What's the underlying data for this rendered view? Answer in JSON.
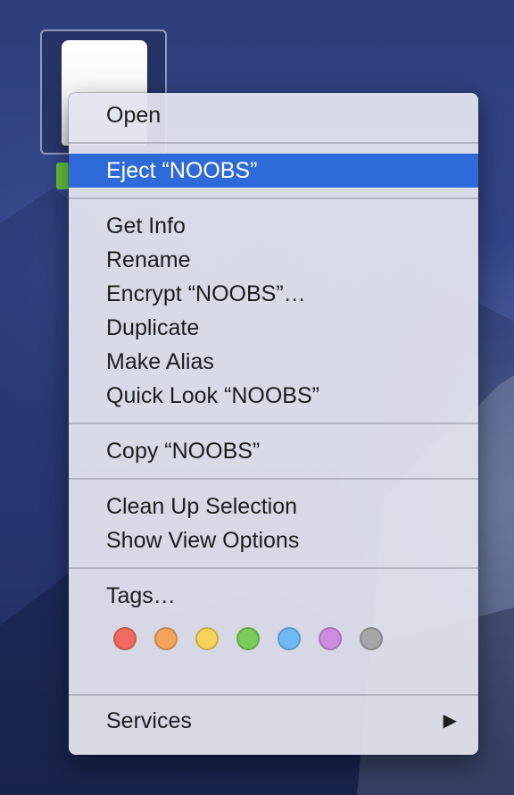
{
  "menu": {
    "groups": [
      {
        "items": [
          "Open"
        ]
      },
      {
        "items": [
          "Eject “NOOBS”"
        ]
      },
      {
        "items": [
          "Get Info",
          "Rename",
          "Encrypt “NOOBS”…",
          "Duplicate",
          "Make Alias",
          "Quick Look “NOOBS”"
        ]
      },
      {
        "items": [
          "Copy “NOOBS”"
        ]
      },
      {
        "items": [
          "Clean Up Selection",
          "Show View Options"
        ]
      },
      {
        "items": [
          "Tags…"
        ]
      },
      {
        "items": [
          "Services"
        ]
      }
    ],
    "highlighted_item": "Eject “NOOBS”",
    "submenu_arrow": "▶",
    "tag_colors": [
      {
        "name": "red",
        "color": "#f26b5e"
      },
      {
        "name": "orange",
        "color": "#f5a55a"
      },
      {
        "name": "yellow",
        "color": "#f5d45a"
      },
      {
        "name": "green",
        "color": "#7ccc5a"
      },
      {
        "name": "blue",
        "color": "#6fb9f5"
      },
      {
        "name": "purple",
        "color": "#cf8ce0"
      },
      {
        "name": "gray",
        "color": "#a7a7ab"
      }
    ],
    "highlight_color": "#2f6bd8"
  },
  "desktop": {
    "drive_icon": "external-drive-icon",
    "label_color": "#66c03a"
  }
}
